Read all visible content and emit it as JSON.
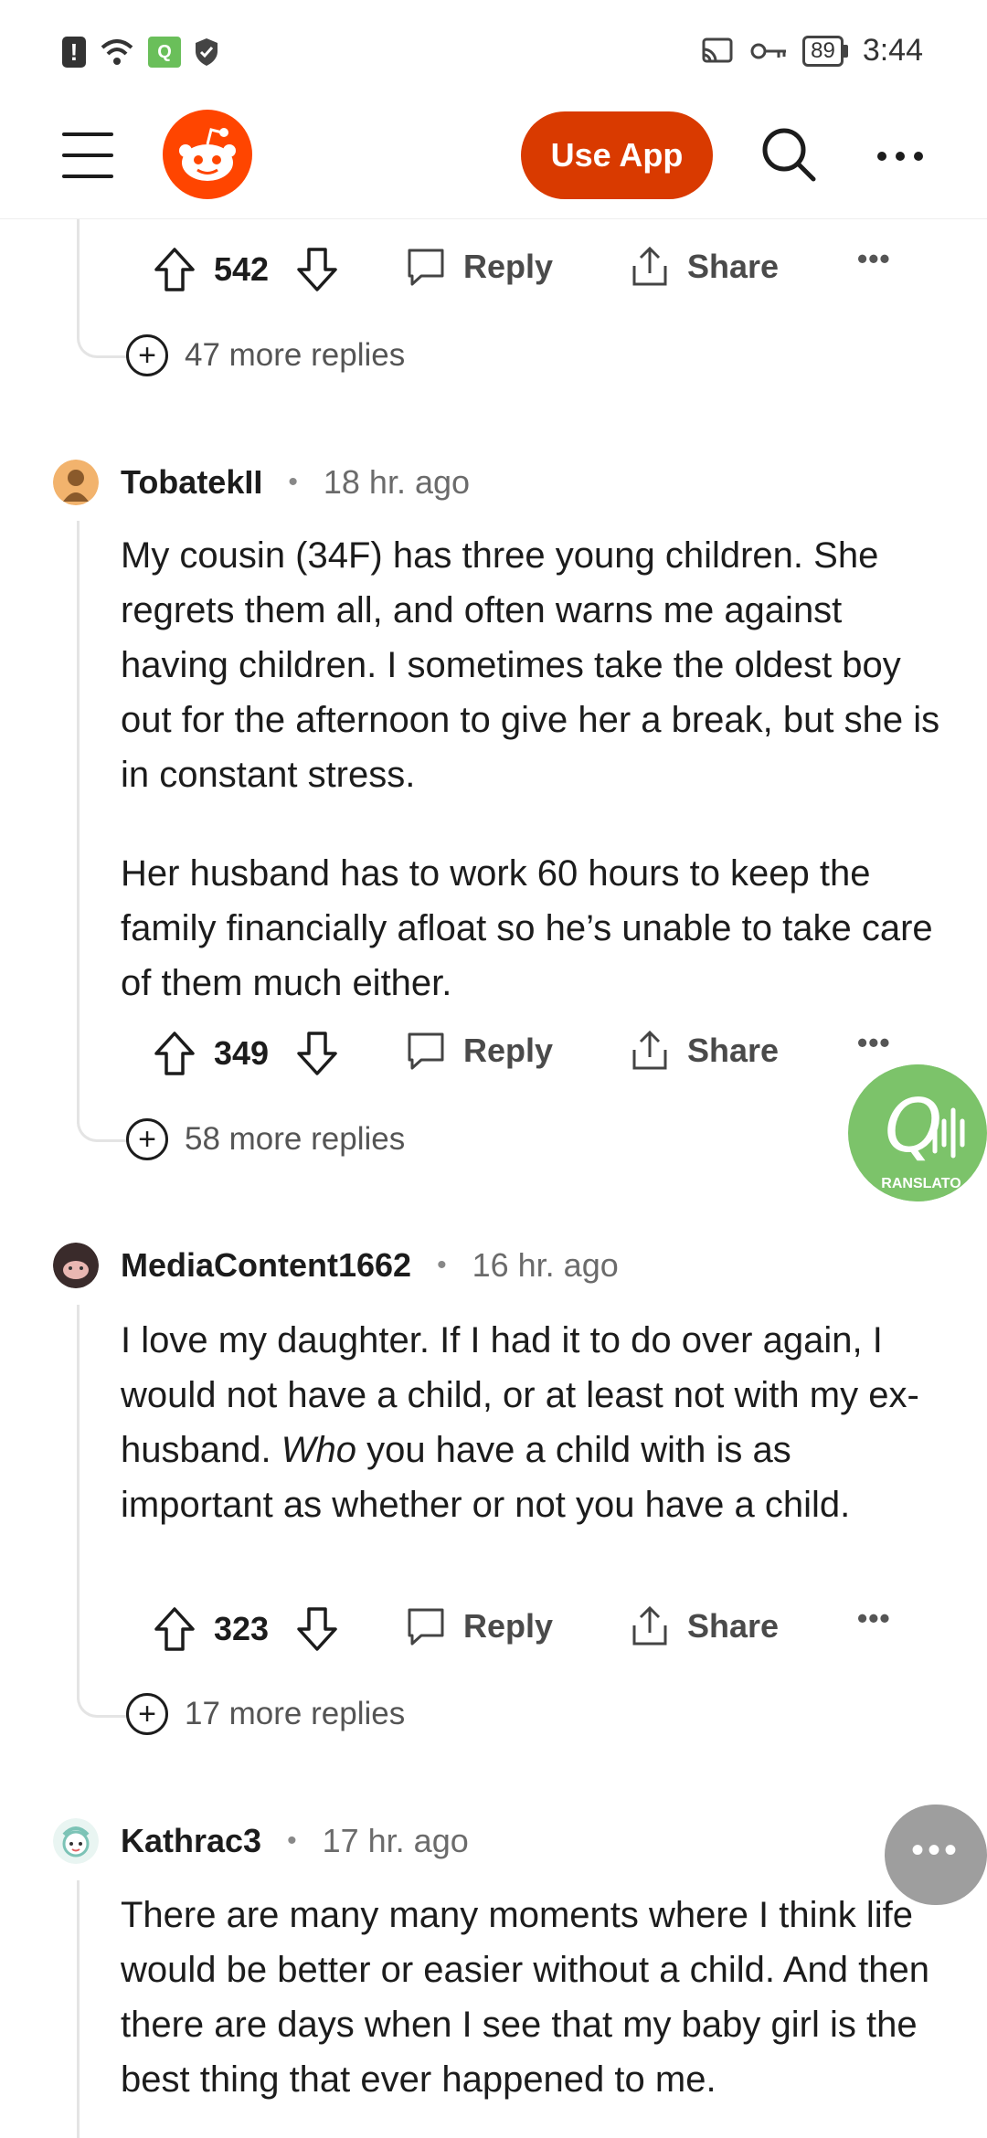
{
  "status_bar": {
    "time": "3:44",
    "battery": "89",
    "signal_label": "6"
  },
  "header": {
    "use_app_label": "Use App"
  },
  "top_actions": {
    "score": "542",
    "reply_label": "Reply",
    "share_label": "Share",
    "more_replies": "47 more replies"
  },
  "comments": [
    {
      "username": "TobatekII",
      "time": "18 hr. ago",
      "paragraphs": [
        "My cousin (34F) has three young children. She regrets them all, and often warns me against having children. I sometimes take the oldest boy out for the afternoon to give her a break, but she is in constant stress.",
        "Her husband has to work 60 hours to keep the family financially afloat so he’s unable to take care of them much either."
      ],
      "score": "349",
      "reply_label": "Reply",
      "share_label": "Share",
      "more_replies": "58 more replies"
    },
    {
      "username": "MediaContent1662",
      "time": "16 hr. ago",
      "text_before_em": "I love my daughter. If I had it to do over again, I would not have a child, or at least not with my ex-husband. ",
      "text_em": "Who",
      "text_after_em": " you have a child with is as important as whether or not you have a child.",
      "score": "323",
      "reply_label": "Reply",
      "share_label": "Share",
      "more_replies": "17 more replies"
    },
    {
      "username": "Kathrac3",
      "time": "17 hr. ago",
      "text": "There are many many moments where I think life would be better or easier without a child. And then there are days when I see that my baby girl is the best thing that ever happened to me."
    }
  ],
  "translator_badge": "RANSLATO",
  "colors": {
    "reddit_orange": "#ff4500",
    "use_app_bg": "#d93a00",
    "translator_green": "#7cc36a"
  }
}
